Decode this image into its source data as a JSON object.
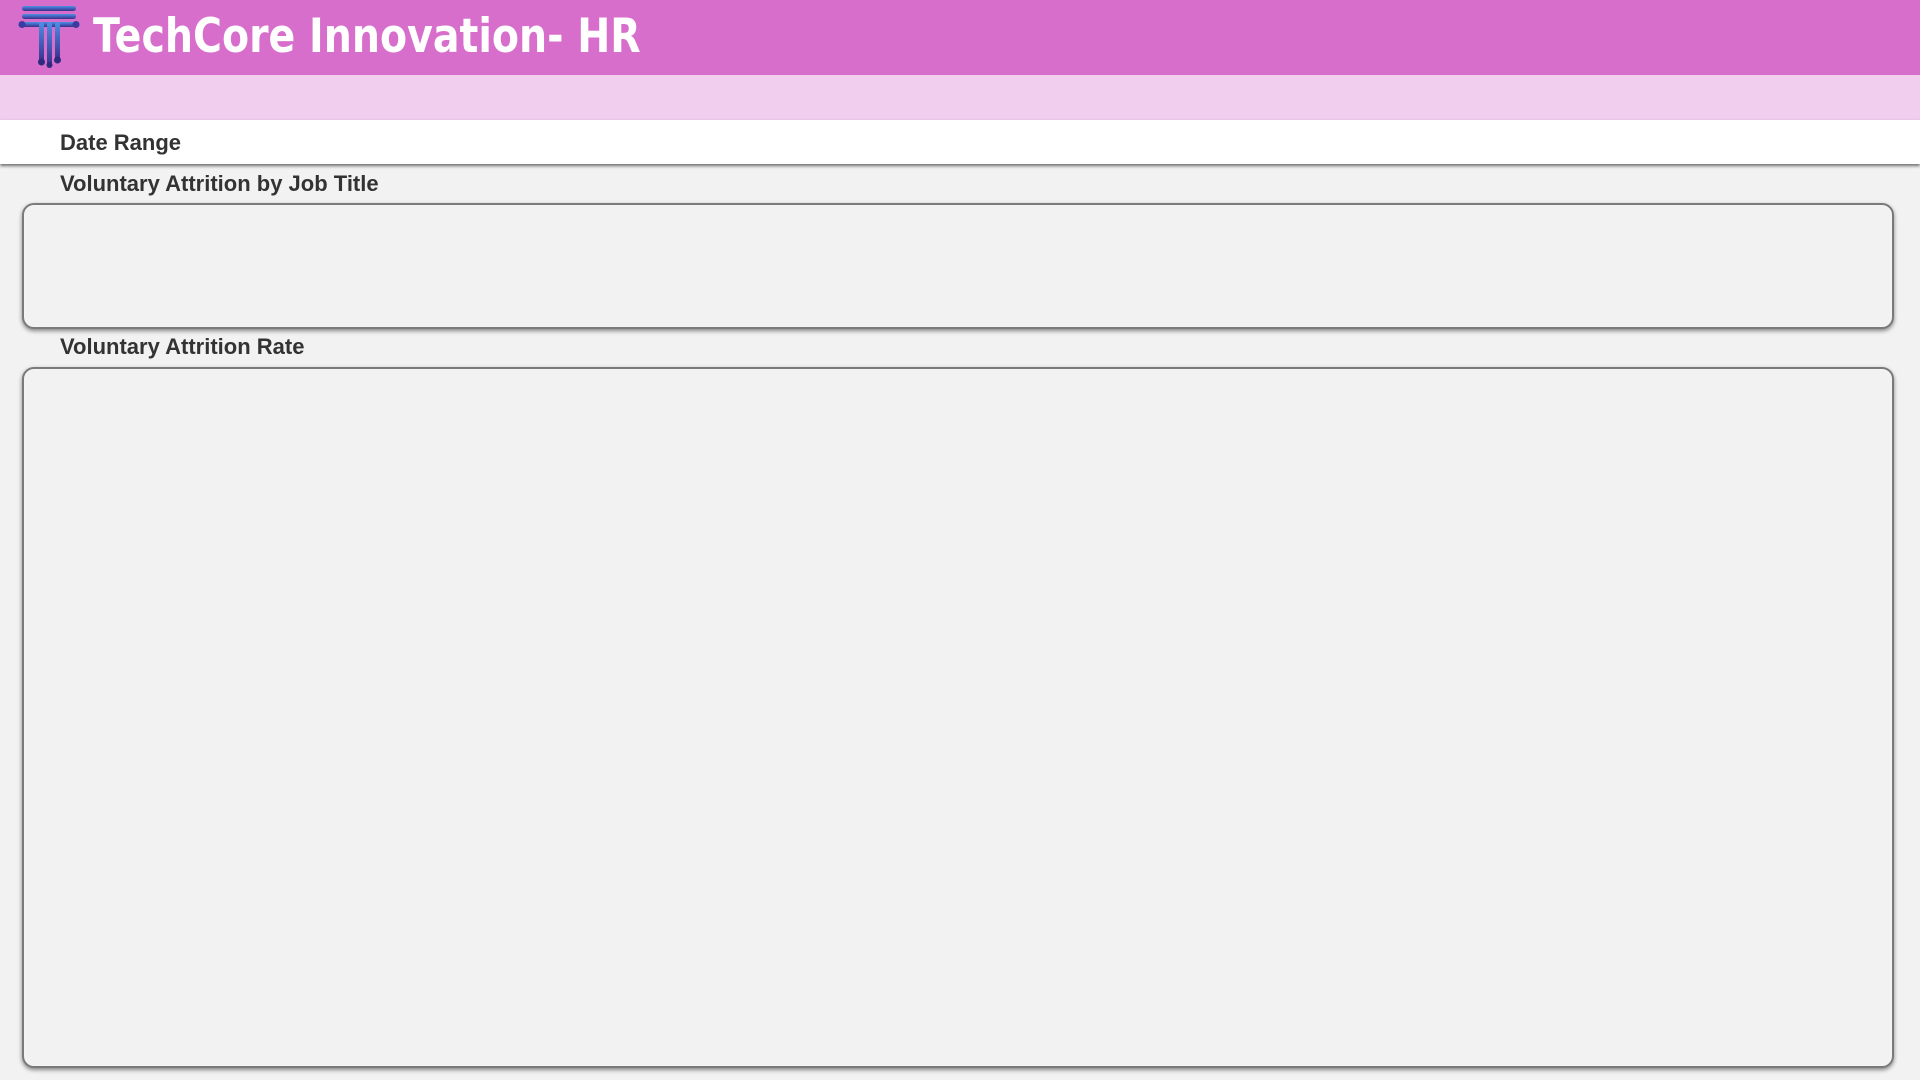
{
  "header": {
    "title": "TechCore Innovation- HR",
    "logo_icon": "letter-t-circuit-icon",
    "background_color": "#d76ecb",
    "title_color": "#ffffff"
  },
  "subband": {
    "background_color": "#f1cdee"
  },
  "filter_bar": {
    "label": "Date Range"
  },
  "sections": {
    "job_title": {
      "label": "Voluntary Attrition by Job Title"
    },
    "rate": {
      "label": "Voluntary Attrition Rate"
    }
  }
}
